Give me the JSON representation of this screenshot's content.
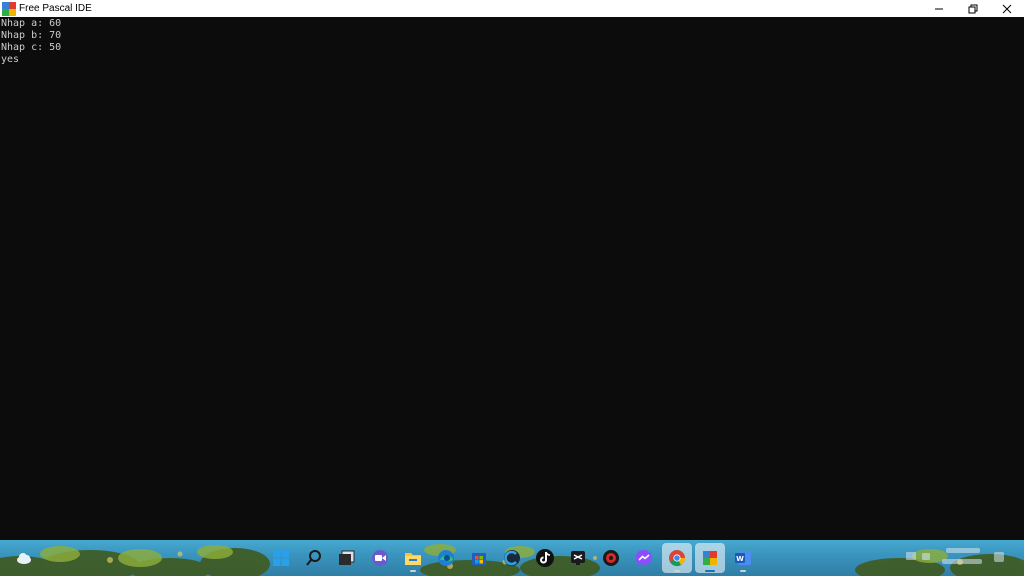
{
  "window": {
    "title": "Free Pascal IDE",
    "controls": [
      "minimize-icon",
      "restore-icon",
      "close-icon"
    ]
  },
  "console": {
    "lines": [
      "Nhap a: 60",
      "Nhap b: 70",
      "Nhap c: 50",
      "yes"
    ],
    "background": "#0c0c0c",
    "text_color": "#cccccc"
  },
  "taskbar": {
    "icons": [
      "weather-icon",
      "start-icon",
      "search-icon",
      "task-view-icon",
      "meet-icon",
      "file-explorer-icon",
      "edge-icon",
      "store-icon",
      "ccleaner-icon",
      "tiktok-icon",
      "capcut-icon",
      "antivirus-icon",
      "messenger-icon",
      "chrome-icon",
      "free-pascal-icon",
      "word-icon"
    ],
    "active_app": "free-pascal-icon",
    "accent": "#3a95be"
  }
}
